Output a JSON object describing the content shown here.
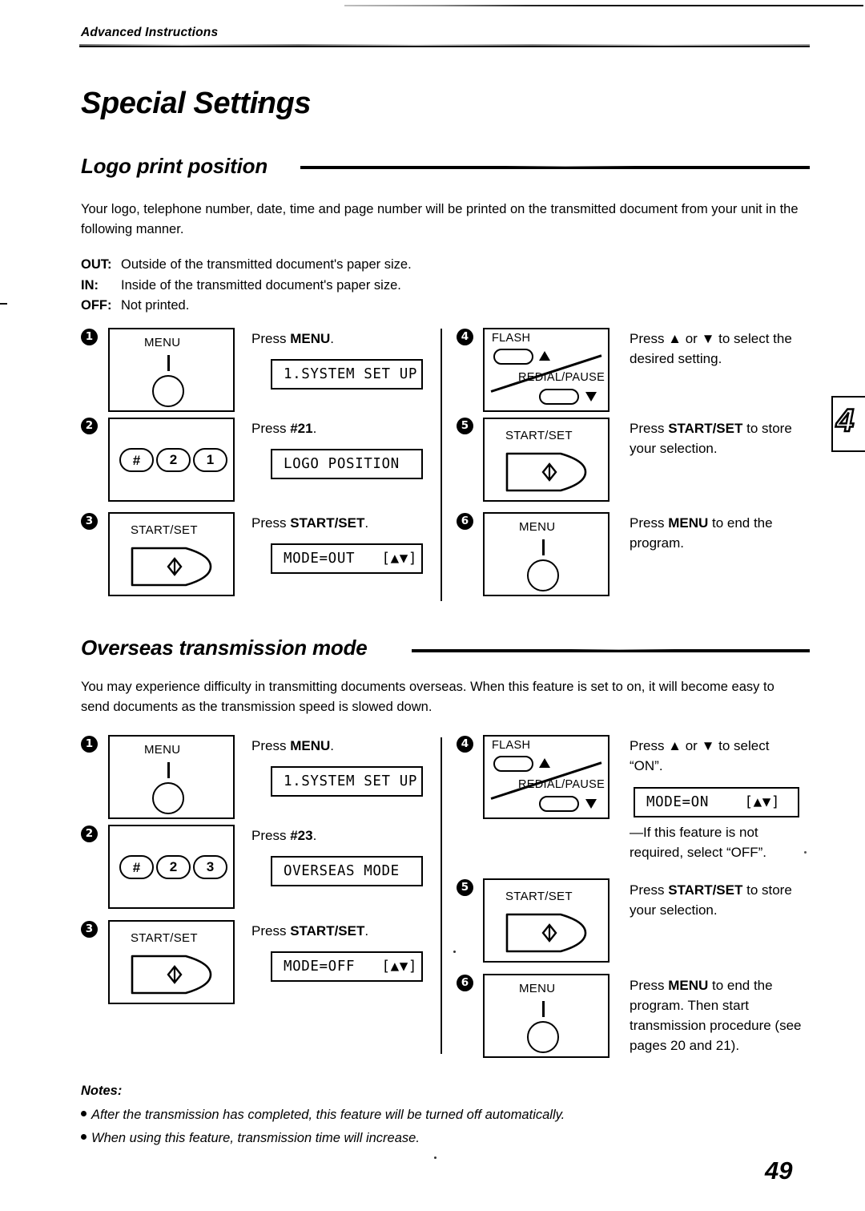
{
  "header": {
    "running_head": "Advanced Instructions",
    "page_number": "49",
    "tab_marker": "4"
  },
  "title": "Special Settings",
  "sections": [
    {
      "id": "logo-print-position",
      "heading": "Logo print position",
      "intro": "Your logo, telephone number, date, time and page number will be printed on the transmitted document from your unit in the following manner.",
      "definitions": [
        {
          "term": "OUT:",
          "desc": "Outside of the transmitted document's paper size."
        },
        {
          "term": "IN:",
          "desc": "Inside of the transmitted document's paper size."
        },
        {
          "term": "OFF:",
          "desc": "Not printed."
        }
      ],
      "steps": [
        {
          "num": "1",
          "panel": "menu",
          "panel_label": "MENU",
          "instruction_html": "Press <b>MENU</b>.",
          "lcd": "1.SYSTEM SET UP"
        },
        {
          "num": "2",
          "panel": "keypad",
          "keys": [
            "#",
            "2",
            "1"
          ],
          "instruction_html": "Press <b>#21</b>.",
          "lcd": "LOGO POSITION"
        },
        {
          "num": "3",
          "panel": "startset",
          "panel_label": "START/SET",
          "instruction_html": "Press <b>START/SET</b>.",
          "lcd": "MODE=OUT   [▲▼]"
        },
        {
          "num": "4",
          "panel": "flash",
          "panel_label_top": "FLASH",
          "panel_label_bottom": "REDIAL/PAUSE",
          "instruction_html": "Press ▲ or ▼ to select the desired setting.",
          "lcd": ""
        },
        {
          "num": "5",
          "panel": "startset",
          "panel_label": "START/SET",
          "instruction_html": "Press <b>START/SET</b> to store your selection.",
          "lcd": ""
        },
        {
          "num": "6",
          "panel": "menu",
          "panel_label": "MENU",
          "instruction_html": "Press <b>MENU</b> to end the program.",
          "lcd": ""
        }
      ]
    },
    {
      "id": "overseas-transmission-mode",
      "heading": "Overseas transmission mode",
      "intro": "You may experience difficulty in transmitting documents overseas. When this feature is set to on, it will become easy to send documents as the transmission speed is slowed down.",
      "steps": [
        {
          "num": "1",
          "panel": "menu",
          "panel_label": "MENU",
          "instruction_html": "Press <b>MENU</b>.",
          "lcd": "1.SYSTEM SET UP"
        },
        {
          "num": "2",
          "panel": "keypad",
          "keys": [
            "#",
            "2",
            "3"
          ],
          "instruction_html": "Press <b>#23</b>.",
          "lcd": "OVERSEAS MODE"
        },
        {
          "num": "3",
          "panel": "startset",
          "panel_label": "START/SET",
          "instruction_html": "Press <b>START/SET</b>.",
          "lcd": "MODE=OFF   [▲▼]"
        },
        {
          "num": "4",
          "panel": "flash",
          "panel_label_top": "FLASH",
          "panel_label_bottom": "REDIAL/PAUSE",
          "instruction_html": "Press ▲ or ▼ to select “ON”.",
          "lcd": "MODE=ON    [▲▼]",
          "note_html": "—If this feature is not required, select “OFF”."
        },
        {
          "num": "5",
          "panel": "startset",
          "panel_label": "START/SET",
          "instruction_html": "Press <b>START/SET</b> to store your selection.",
          "lcd": ""
        },
        {
          "num": "6",
          "panel": "menu",
          "panel_label": "MENU",
          "instruction_html": "Press <b>MENU</b> to end the program. Then start transmission procedure (see pages 20 and 21).",
          "lcd": ""
        }
      ]
    }
  ],
  "notes": {
    "heading": "Notes:",
    "items": [
      "After the transmission has completed, this feature will be turned off automatically.",
      "When using this feature, transmission time will increase."
    ]
  }
}
